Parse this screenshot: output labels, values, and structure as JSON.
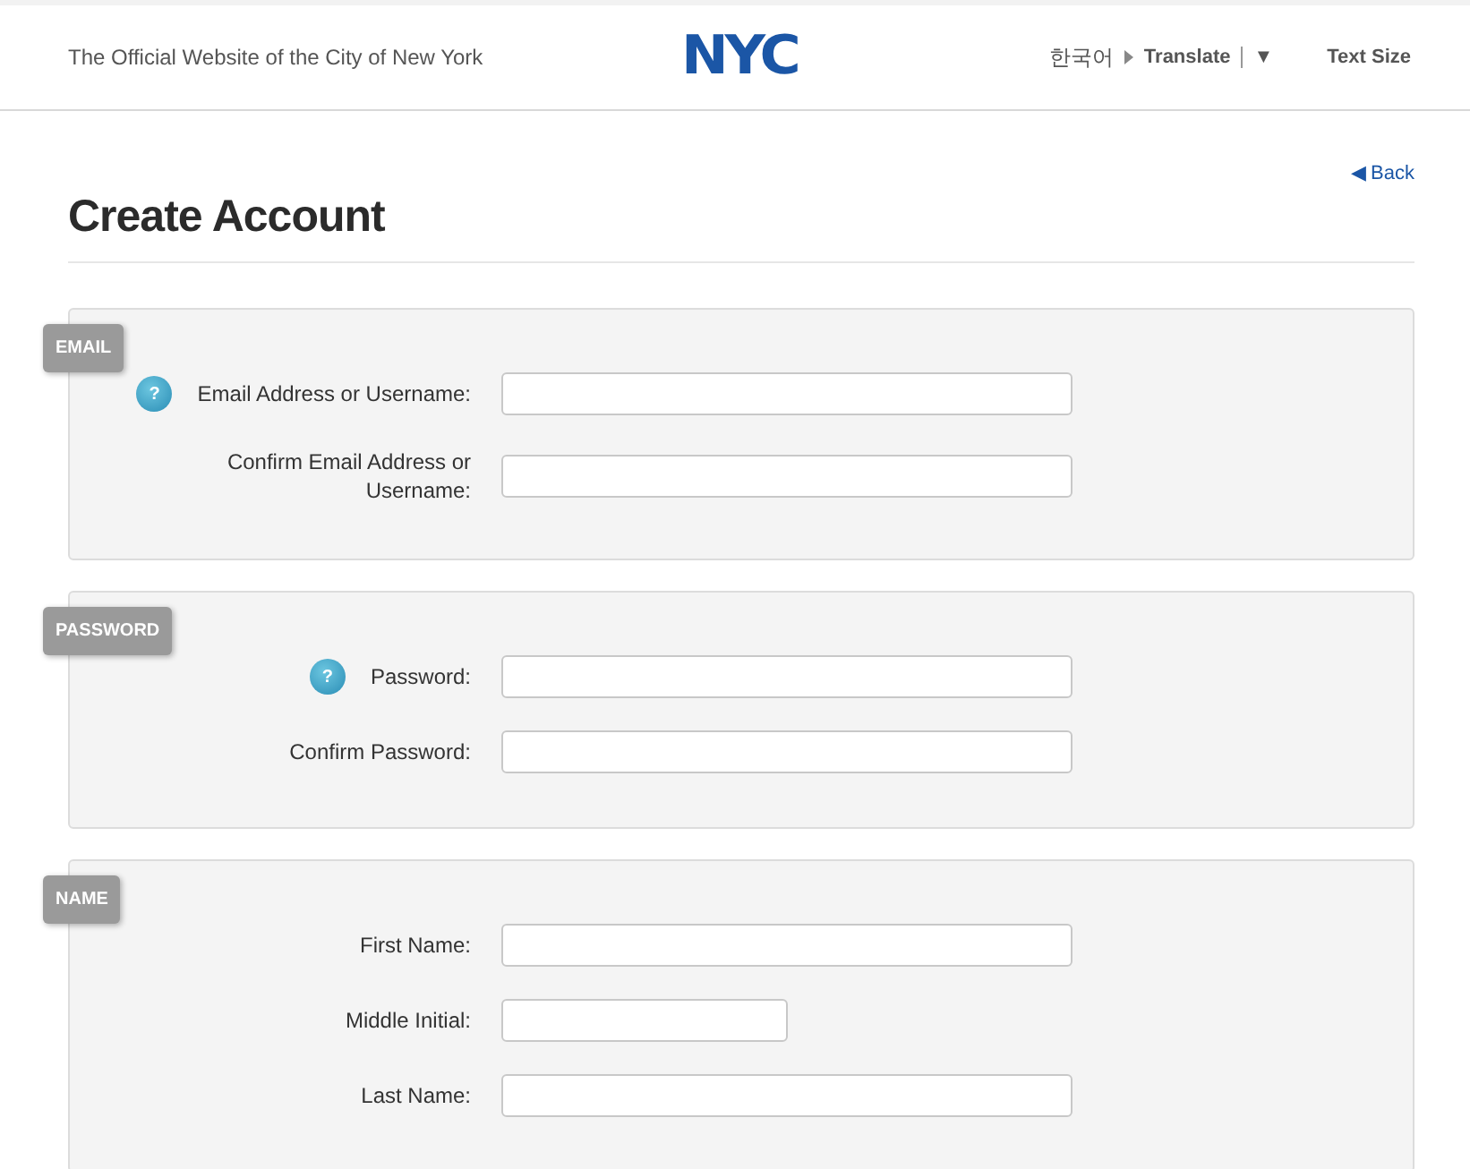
{
  "header": {
    "tagline": "The Official Website of the City of New York",
    "logo": "NYC",
    "language": "한국어",
    "translate": "Translate",
    "translate_caret": "▼",
    "text_size": "Text Size"
  },
  "back": {
    "arrow": "◀",
    "label": "Back"
  },
  "title": "Create Account",
  "sections": [
    {
      "badge": "EMAIL",
      "fields": [
        {
          "label": "Email Address or Username:",
          "help": "?",
          "kind": "long"
        },
        {
          "label": "Confirm Email Address or Username:",
          "kind": "long"
        }
      ]
    },
    {
      "badge": "PASSWORD",
      "fields": [
        {
          "label": "Password:",
          "help": "?",
          "kind": "long"
        },
        {
          "label": "Confirm Password:",
          "kind": "long"
        }
      ]
    },
    {
      "badge": "NAME",
      "fields": [
        {
          "label": "First Name:",
          "kind": "long"
        },
        {
          "label": "Middle Initial:",
          "kind": "short"
        },
        {
          "label": "Last Name:",
          "kind": "long"
        }
      ]
    }
  ]
}
